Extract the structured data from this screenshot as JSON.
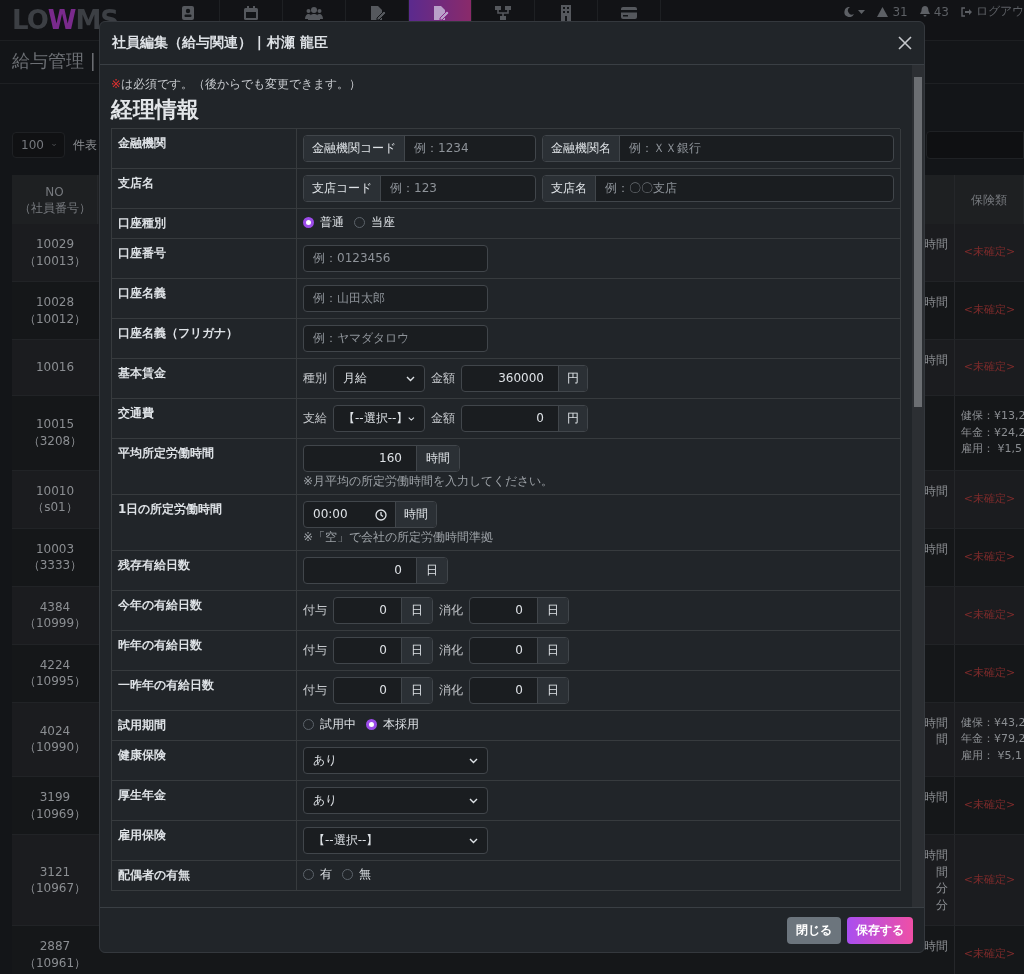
{
  "nav": {
    "logo": {
      "left": "LO",
      "accent": "W",
      "right": "MS"
    },
    "items": [
      {
        "selected": false
      },
      {
        "selected": false
      },
      {
        "selected": false
      },
      {
        "selected": false
      },
      {
        "selected": true
      },
      {
        "selected": false
      },
      {
        "selected": false
      },
      {
        "selected": false
      }
    ],
    "alerts": "31",
    "notifications": "43",
    "logout": "ログアウ"
  },
  "page": {
    "title": "給与管理 |",
    "per_page": "100",
    "per_page_suffix": "件表"
  },
  "table": {
    "columns": [
      [
        "NO",
        "（社員番号）"
      ],
      [
        "保険類"
      ]
    ],
    "rows": [
      {
        "no": [
          "10029",
          "（10013）"
        ],
        "column_2": [
          "時間"
        ],
        "insurance": [
          "<未確定>"
        ],
        "pending": true
      },
      {
        "no": [
          "10028",
          "（10012）"
        ],
        "column_2": [
          "時間"
        ],
        "insurance": [
          "<未確定>"
        ],
        "pending": true
      },
      {
        "no": [
          "10016"
        ],
        "column_2": [
          "時間"
        ],
        "insurance": [
          "<未確定>"
        ],
        "pending": true
      },
      {
        "no": [
          "10015",
          "（3208）"
        ],
        "column_2": [],
        "insurance": [
          "健保：¥13,2",
          "年金：¥24,2",
          "雇用：  ¥1,5"
        ],
        "pending": false
      },
      {
        "no": [
          "10010",
          "（s01）"
        ],
        "column_2": [
          "時間"
        ],
        "insurance": [
          "<未確定>"
        ],
        "pending": true
      },
      {
        "no": [
          "10003",
          "（3333）"
        ],
        "column_2": [
          "時間"
        ],
        "insurance": [
          "<未確定>"
        ],
        "pending": true
      },
      {
        "no": [
          "4384",
          "（10999）"
        ],
        "column_2": [],
        "insurance": [
          "<未確定>"
        ],
        "pending": true
      },
      {
        "no": [
          "4224",
          "（10995）"
        ],
        "column_2": [],
        "insurance": [
          "<未確定>"
        ],
        "pending": true
      },
      {
        "no": [
          "4024",
          "（10990）"
        ],
        "column_2": [
          "時間",
          "間"
        ],
        "insurance": [
          "健保：¥43,2",
          "年金：¥79,2",
          "雇用：  ¥5,1"
        ],
        "pending": false
      },
      {
        "no": [
          "3199",
          "（10969）"
        ],
        "column_2": [
          "時間"
        ],
        "insurance": [
          "<未確定>"
        ],
        "pending": true
      },
      {
        "no": [
          "3121",
          "（10967）"
        ],
        "column_2": [
          "時間",
          "間",
          "分",
          "分"
        ],
        "insurance": [
          "<未確定>"
        ],
        "pending": true
      },
      {
        "no": [
          "2887",
          "（10961）"
        ],
        "column_2": [
          "時間"
        ],
        "insurance": [
          "<未確定>"
        ],
        "pending": true
      }
    ]
  },
  "modal": {
    "title": "社員編集（給与関連） | 村瀬 龍臣",
    "required_note": {
      "mark": "※",
      "text": "は必須です。（後からでも変更できます。）"
    },
    "section": "経理情報",
    "rows": [
      {
        "label": "金融機関",
        "kind": "bank",
        "controls": [
          {
            "kind": "addon_input",
            "addon": "金融機関コード",
            "placeholder": "例：1234"
          },
          {
            "kind": "addon_input",
            "addon": "金融機関名",
            "placeholder": "例：ＸＸ銀行"
          }
        ]
      },
      {
        "label": "支店名",
        "kind": "bank",
        "controls": [
          {
            "kind": "addon_input",
            "addon": "支店コード",
            "placeholder": "例：123"
          },
          {
            "kind": "addon_input",
            "addon": "支店名",
            "placeholder": "例：〇〇支店"
          }
        ]
      },
      {
        "label": "口座種別",
        "kind": "radio",
        "controls": [
          {
            "kind": "radio",
            "label": "普通",
            "selected": true
          },
          {
            "kind": "radio",
            "label": "当座",
            "selected": false
          }
        ]
      },
      {
        "label": "口座番号",
        "kind": "input",
        "controls": [
          {
            "kind": "input",
            "placeholder": "例：0123456"
          }
        ]
      },
      {
        "label": "口座名義",
        "kind": "input",
        "controls": [
          {
            "kind": "input",
            "placeholder": "例：山田太郎"
          }
        ]
      },
      {
        "label": "口座名義（フリガナ）",
        "kind": "input",
        "controls": [
          {
            "kind": "input",
            "placeholder": "例：ヤマダタロウ"
          }
        ]
      },
      {
        "label": "基本賃金",
        "kind": "pay",
        "controls": [
          {
            "kind": "text",
            "text": "種別"
          },
          {
            "kind": "select",
            "value": "月給"
          },
          {
            "kind": "text",
            "text": "金額"
          },
          {
            "kind": "number_unit",
            "value": "360000",
            "unit": "円"
          }
        ]
      },
      {
        "label": "交通費",
        "kind": "pay",
        "controls": [
          {
            "kind": "text",
            "text": "支給"
          },
          {
            "kind": "select",
            "value": "【--選択--】"
          },
          {
            "kind": "text",
            "text": "金額"
          },
          {
            "kind": "number_unit",
            "value": "0",
            "unit": "円"
          }
        ]
      },
      {
        "label": "平均所定労働時間",
        "kind": "hours",
        "controls": [
          {
            "kind": "number_unit",
            "value": "160",
            "unit": "時間"
          }
        ],
        "note": "※月平均の所定労働時間を入力してください。"
      },
      {
        "label": "1日の所定労働時間",
        "kind": "time",
        "controls": [
          {
            "kind": "time_unit",
            "value": "00:00",
            "unit": "時間"
          }
        ],
        "note": "※「空」で会社の所定労働時間準拠"
      },
      {
        "label": "残存有給日数",
        "kind": "days",
        "controls": [
          {
            "kind": "number_unit",
            "value": "0",
            "unit": "日"
          }
        ]
      },
      {
        "label": "今年の有給日数",
        "kind": "pair",
        "controls": [
          {
            "kind": "text",
            "text": "付与"
          },
          {
            "kind": "number_unit",
            "value": "0",
            "unit": "日"
          },
          {
            "kind": "text",
            "text": "消化"
          },
          {
            "kind": "number_unit",
            "value": "0",
            "unit": "日"
          }
        ]
      },
      {
        "label": "昨年の有給日数",
        "kind": "pair",
        "controls": [
          {
            "kind": "text",
            "text": "付与"
          },
          {
            "kind": "number_unit",
            "value": "0",
            "unit": "日"
          },
          {
            "kind": "text",
            "text": "消化"
          },
          {
            "kind": "number_unit",
            "value": "0",
            "unit": "日"
          }
        ]
      },
      {
        "label": "一昨年の有給日数",
        "kind": "pair",
        "controls": [
          {
            "kind": "text",
            "text": "付与"
          },
          {
            "kind": "number_unit",
            "value": "0",
            "unit": "日"
          },
          {
            "kind": "text",
            "text": "消化"
          },
          {
            "kind": "number_unit",
            "value": "0",
            "unit": "日"
          }
        ]
      },
      {
        "label": "試用期間",
        "kind": "radio",
        "controls": [
          {
            "kind": "radio",
            "label": "試用中",
            "selected": false
          },
          {
            "kind": "radio",
            "label": "本採用",
            "selected": true
          }
        ]
      },
      {
        "label": "健康保険",
        "kind": "input",
        "controls": [
          {
            "kind": "select",
            "value": "あり"
          }
        ]
      },
      {
        "label": "厚生年金",
        "kind": "input",
        "controls": [
          {
            "kind": "select",
            "value": "あり"
          }
        ]
      },
      {
        "label": "雇用保険",
        "kind": "input",
        "controls": [
          {
            "kind": "select",
            "value": "【--選択--】"
          }
        ]
      },
      {
        "label": "配偶者の有無",
        "kind": "radio",
        "controls": [
          {
            "kind": "radio",
            "label": "有",
            "selected": false
          },
          {
            "kind": "radio",
            "label": "無",
            "selected": false
          }
        ]
      }
    ],
    "buttons": [
      {
        "label": "閉じる",
        "kind": "secondary"
      },
      {
        "label": "保存する",
        "kind": "primary"
      }
    ]
  }
}
